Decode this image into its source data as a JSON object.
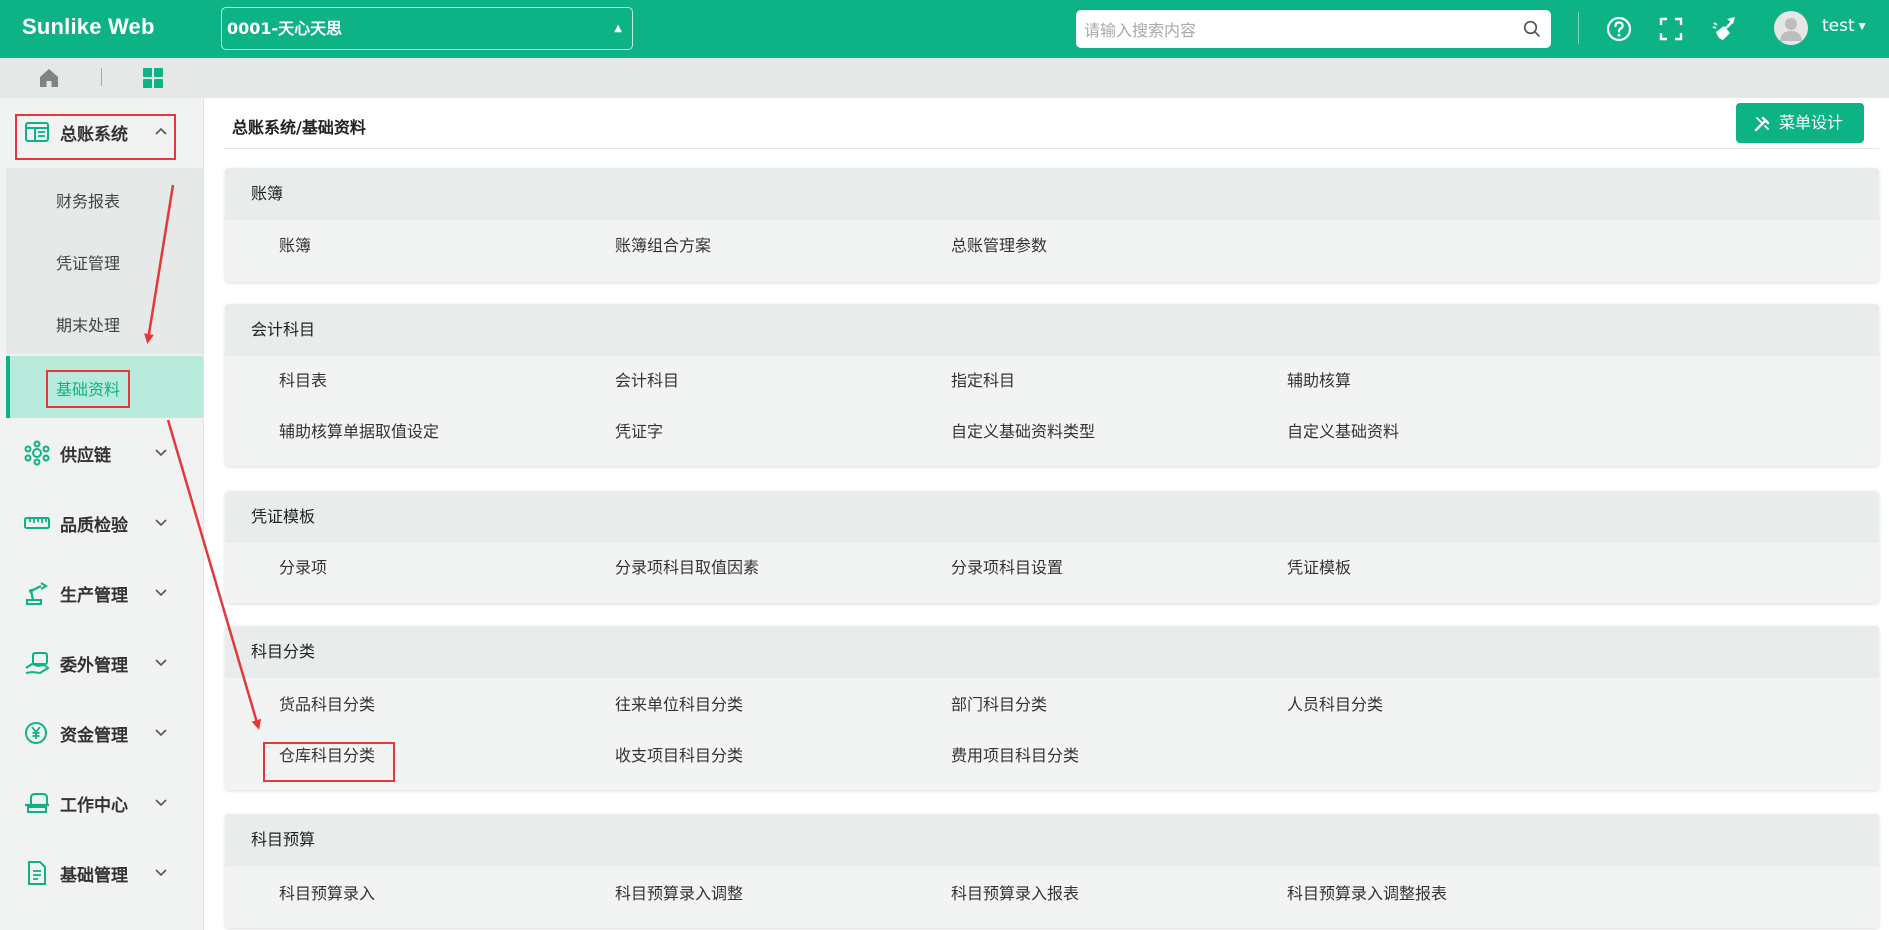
{
  "app": {
    "brand": "Sunlike Web"
  },
  "topbar": {
    "company": "0001-天心天思",
    "search_placeholder": "请输入搜索内容",
    "user": "test",
    "icons": [
      "help-icon",
      "fullscreen-icon",
      "clear-cache-icon",
      "avatar"
    ]
  },
  "tabbar": {
    "icons": [
      "home-icon",
      "dashboard-grid-icon"
    ]
  },
  "sidebar": {
    "active_item": "基础资料",
    "items": [
      {
        "label": "总账系统",
        "icon": "ledger-icon",
        "expanded": true,
        "children": [
          "财务报表",
          "凭证管理",
          "期末处理",
          "基础资料"
        ]
      },
      {
        "label": "供应链",
        "icon": "supply-chain-icon"
      },
      {
        "label": "品质检验",
        "icon": "ruler-icon"
      },
      {
        "label": "生产管理",
        "icon": "robot-arm-icon"
      },
      {
        "label": "委外管理",
        "icon": "handshake-icon"
      },
      {
        "label": "资金管理",
        "icon": "yuan-icon"
      },
      {
        "label": "工作中心",
        "icon": "workstation-icon"
      },
      {
        "label": "基础管理",
        "icon": "document-icon"
      }
    ]
  },
  "main": {
    "breadcrumb": "总账系统/基础资料",
    "design_button": "菜单设计",
    "sections": [
      {
        "title": "账簿",
        "items": [
          "账簿",
          "账簿组合方案",
          "总账管理参数"
        ]
      },
      {
        "title": "会计科目",
        "items": [
          "科目表",
          "会计科目",
          "指定科目",
          "辅助核算",
          "辅助核算单据取值设定",
          "凭证字",
          "自定义基础资料类型",
          "自定义基础资料"
        ]
      },
      {
        "title": "凭证模板",
        "items": [
          "分录项",
          "分录项科目取值因素",
          "分录项科目设置",
          "凭证模板"
        ]
      },
      {
        "title": "科目分类",
        "items": [
          "货品科目分类",
          "往来单位科目分类",
          "部门科目分类",
          "人员科目分类",
          "仓库科目分类",
          "收支项目科目分类",
          "费用项目科目分类"
        ]
      },
      {
        "title": "科目预算",
        "items": [
          "科目预算录入",
          "科目预算录入调整",
          "科目预算录入报表",
          "科目预算录入调整报表"
        ]
      }
    ]
  },
  "colors": {
    "accent": "#0db384",
    "annotation": "#e5383b",
    "active_bg": "#b9ebdc"
  }
}
